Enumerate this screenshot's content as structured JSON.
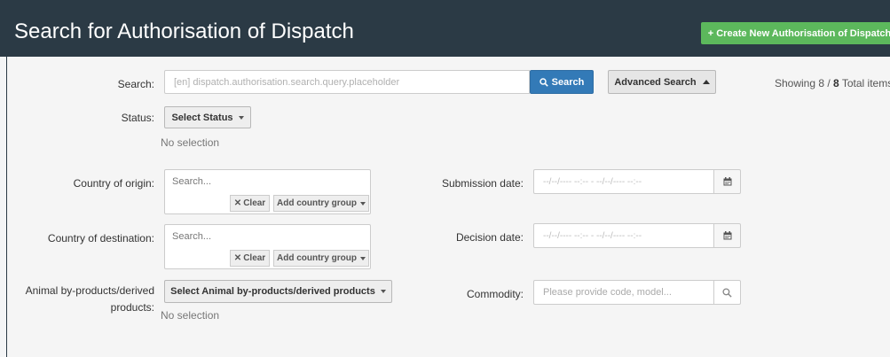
{
  "header": {
    "title": "Search for Authorisation of Dispatch",
    "create_button": "+ Create New Authorisation of Dispatch"
  },
  "search": {
    "label": "Search:",
    "placeholder": "[en] dispatch.authorisation.search.query.placeholder",
    "search_button": "Search",
    "advanced_button": "Advanced Search",
    "showing_prefix": "Showing 8 / ",
    "showing_total": "8",
    "showing_suffix": " Total items"
  },
  "status": {
    "label": "Status:",
    "dropdown": "Select Status",
    "selection": "No selection"
  },
  "country_origin": {
    "label": "Country of origin:",
    "placeholder": "Search...",
    "clear": "Clear",
    "add_group": "Add country group"
  },
  "country_destination": {
    "label": "Country of destination:",
    "placeholder": "Search...",
    "clear": "Clear",
    "add_group": "Add country group"
  },
  "submission_date": {
    "label": "Submission date:",
    "placeholder": "--/--/---- --:-- - --/--/---- --:--"
  },
  "decision_date": {
    "label": "Decision date:",
    "placeholder": "--/--/---- --:-- - --/--/---- --:--"
  },
  "animal_products": {
    "label": "Animal by-products/derived products:",
    "dropdown": "Select Animal by-products/derived products",
    "selection": "No selection"
  },
  "commodity": {
    "label": "Commodity:",
    "placeholder": "Please provide code, model..."
  },
  "colors": {
    "header_bg": "#2b3a45",
    "create_button": "#5cb85c",
    "primary_button": "#337ab7"
  },
  "icons": {
    "search": "magnifier-icon",
    "calendar": "calendar-icon",
    "close": "times-icon"
  }
}
